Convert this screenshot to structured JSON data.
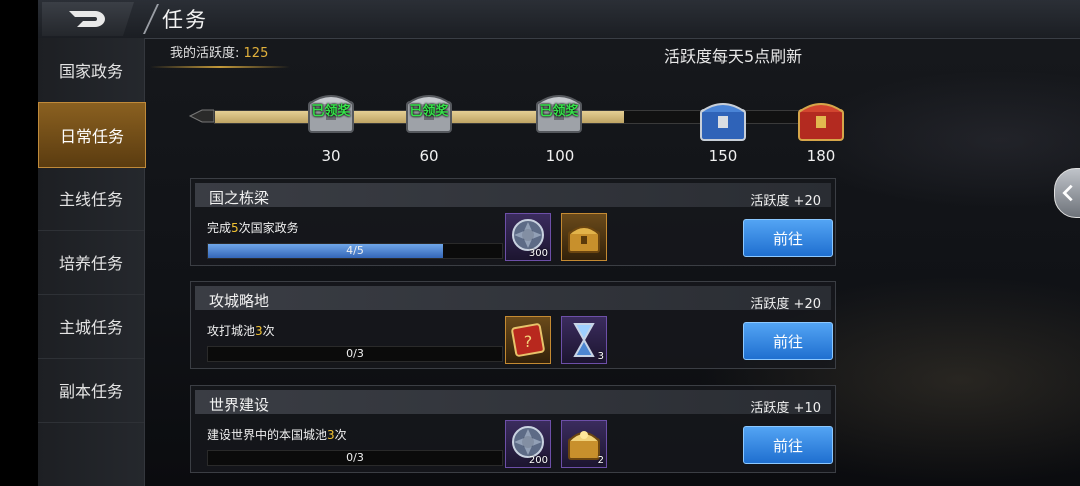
{
  "header": {
    "title": "任务",
    "back_icon": "back-arrow-icon"
  },
  "sidebar": {
    "items": [
      {
        "label": "国家政务",
        "active": false
      },
      {
        "label": "日常任务",
        "active": true
      },
      {
        "label": "主线任务",
        "active": false
      },
      {
        "label": "培养任务",
        "active": false
      },
      {
        "label": "主城任务",
        "active": false
      },
      {
        "label": "副本任务",
        "active": false
      }
    ]
  },
  "activity": {
    "label": "我的活跃度:",
    "value": "125",
    "refresh_note": "活跃度每天5点刷新",
    "progress_fraction": 0.66,
    "chests": [
      {
        "threshold": "30",
        "status": "已领奖",
        "type": "silver"
      },
      {
        "threshold": "60",
        "status": "已领奖",
        "type": "silver"
      },
      {
        "threshold": "100",
        "status": "已领奖",
        "type": "silver"
      },
      {
        "threshold": "150",
        "status": "",
        "type": "blue"
      },
      {
        "threshold": "180",
        "status": "",
        "type": "red"
      }
    ]
  },
  "tasks": [
    {
      "title": "国之栋梁",
      "points": "活跃度 +20",
      "desc_pre": "完成",
      "desc_hl": "5",
      "desc_post": "次国家政务",
      "progress_text": "4/5",
      "progress_fraction": 0.8,
      "button": "前往",
      "rewards": [
        {
          "icon": "silver-coin-icon",
          "count": "300",
          "style": "purple"
        },
        {
          "icon": "gold-chest-icon",
          "count": "",
          "style": "gold"
        }
      ]
    },
    {
      "title": "攻城略地",
      "points": "活跃度 +20",
      "desc_pre": "攻打城池",
      "desc_hl": "3",
      "desc_post": "次",
      "progress_text": "0/3",
      "progress_fraction": 0,
      "button": "前往",
      "rewards": [
        {
          "icon": "mystery-scroll-icon",
          "count": "",
          "style": "gold"
        },
        {
          "icon": "hourglass-icon",
          "count": "3",
          "style": "purple"
        }
      ]
    },
    {
      "title": "世界建设",
      "points": "活跃度 +10",
      "desc_pre": "建设世界中的本国城池",
      "desc_hl": "3",
      "desc_post": "次",
      "progress_text": "0/3",
      "progress_fraction": 0,
      "button": "前往",
      "rewards": [
        {
          "icon": "silver-coin-icon",
          "count": "200",
          "style": "purple"
        },
        {
          "icon": "treasure-chest-icon",
          "count": "2",
          "style": "purple"
        }
      ]
    }
  ],
  "colors": {
    "accent_gold": "#e2b13c",
    "button_blue": "#1f6fd0",
    "claimed_green": "#36e24a"
  }
}
